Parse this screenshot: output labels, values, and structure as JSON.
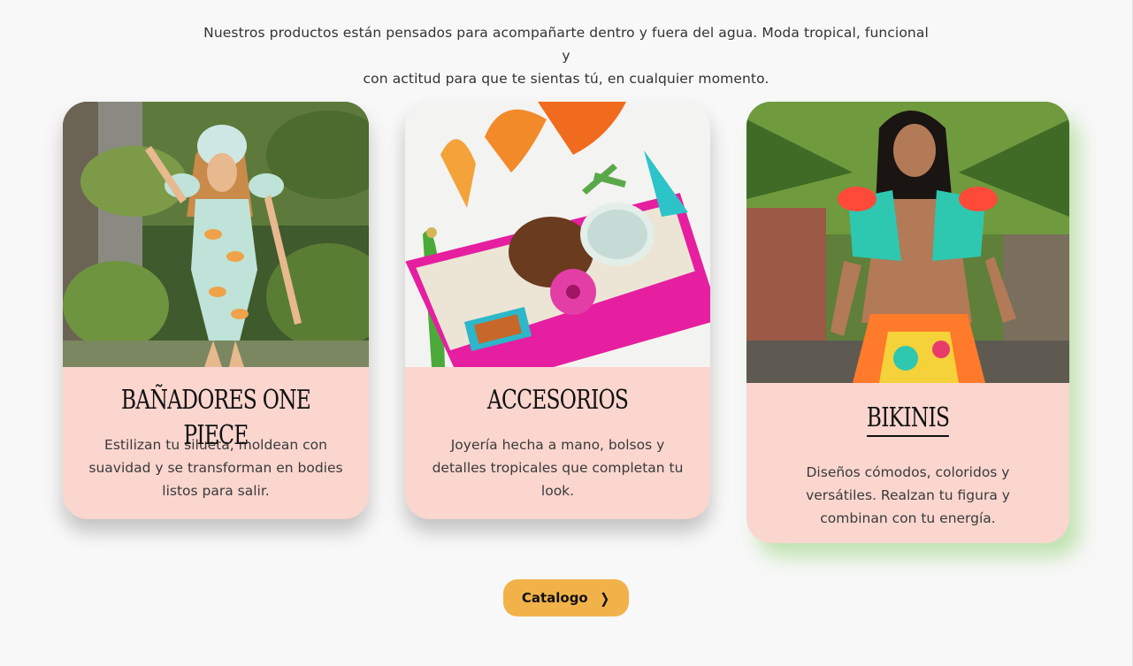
{
  "intro": {
    "line1": "Nuestros productos están pensados para acompañarte dentro y fuera del agua. Moda tropical, funcional y",
    "line2": "con actitud para que te sientas tú, en cualquier momento."
  },
  "cards": [
    {
      "title": "BAÑADORES ONE PIECE",
      "desc_lines": [
        "Estilizan tu silueta, moldean con",
        "suavidad y se transforman en bodies",
        "listos para salir."
      ]
    },
    {
      "title": "ACCESORIOS",
      "desc_lines": [
        "Joyería hecha a mano, bolsos y",
        "detalles tropicales que completan tu",
        "look."
      ]
    },
    {
      "title": "BIKINIS",
      "desc_lines": [
        "Diseños cómodos, coloridos y",
        "versátiles. Realzan tu figura y",
        "combinan con tu energía."
      ]
    }
  ],
  "catalog_button": {
    "label": "Catalogo",
    "icon": "chevron-right-icon"
  },
  "colors": {
    "card_bg": "#fad6cf",
    "button_bg": "#f2b24a",
    "page_bg": "#f8f8f8"
  }
}
